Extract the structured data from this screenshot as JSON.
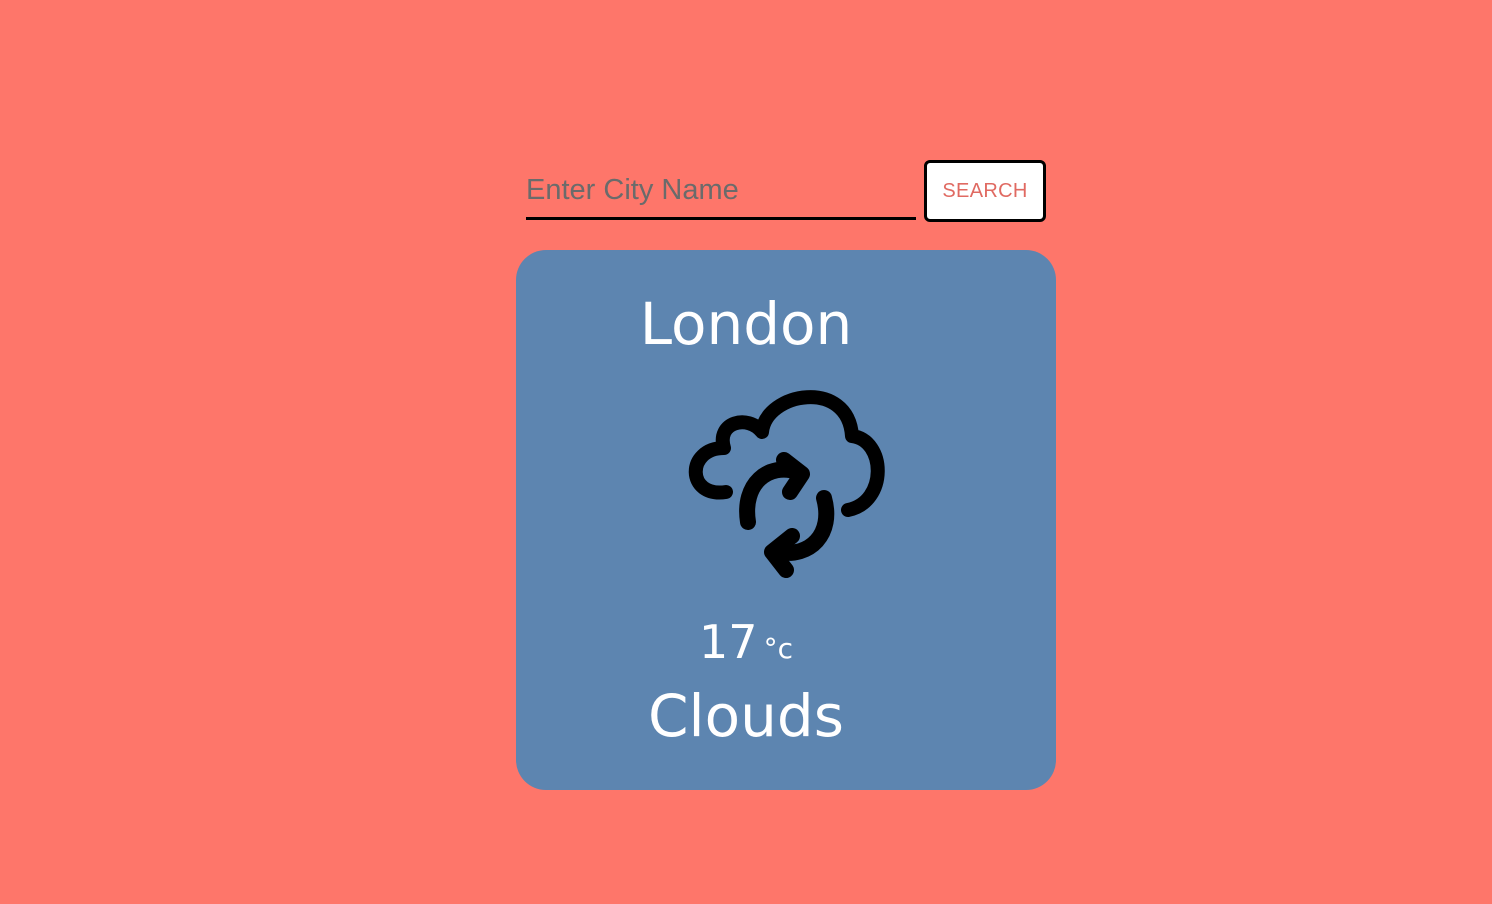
{
  "search": {
    "placeholder": "Enter City Name",
    "value": "",
    "button_label": "SEARCH"
  },
  "weather": {
    "city": "London",
    "temperature": "17",
    "unit": "°c",
    "condition": "Clouds",
    "icon": "cloud-sync-icon"
  },
  "colors": {
    "background": "#fe766a",
    "card": "#5d85b0",
    "button_text": "#e06a62",
    "text": "#ffffff"
  }
}
